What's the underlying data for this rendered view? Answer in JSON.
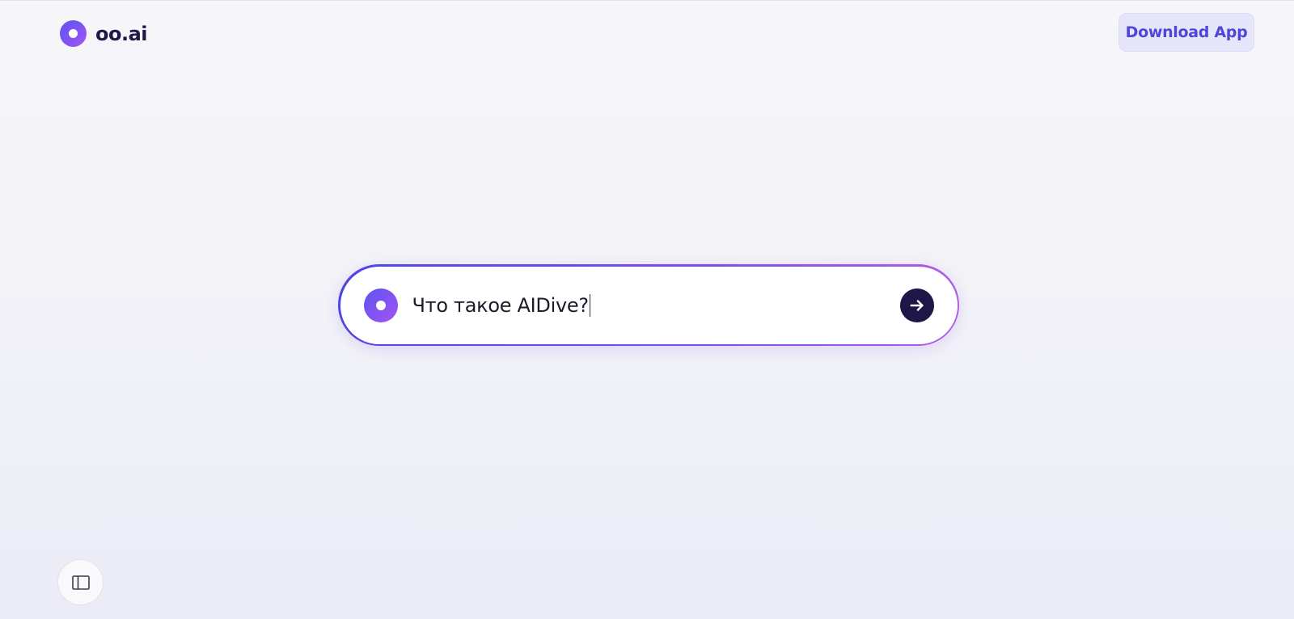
{
  "header": {
    "logo_text": "oo.ai",
    "download_label": "Download App"
  },
  "search": {
    "value": "Что такое AIDive?",
    "logo_icon": "oo-logo-icon",
    "send_icon": "arrow-right-icon"
  },
  "footer": {
    "sidebar_toggle_icon": "sidebar-panel-icon"
  },
  "colors": {
    "brand_gradient_start": "#5b54f0",
    "brand_gradient_end": "#a454f2",
    "brand_dark": "#1c1747",
    "download_text": "#4f46d8",
    "download_bg": "#e6e6fb"
  }
}
